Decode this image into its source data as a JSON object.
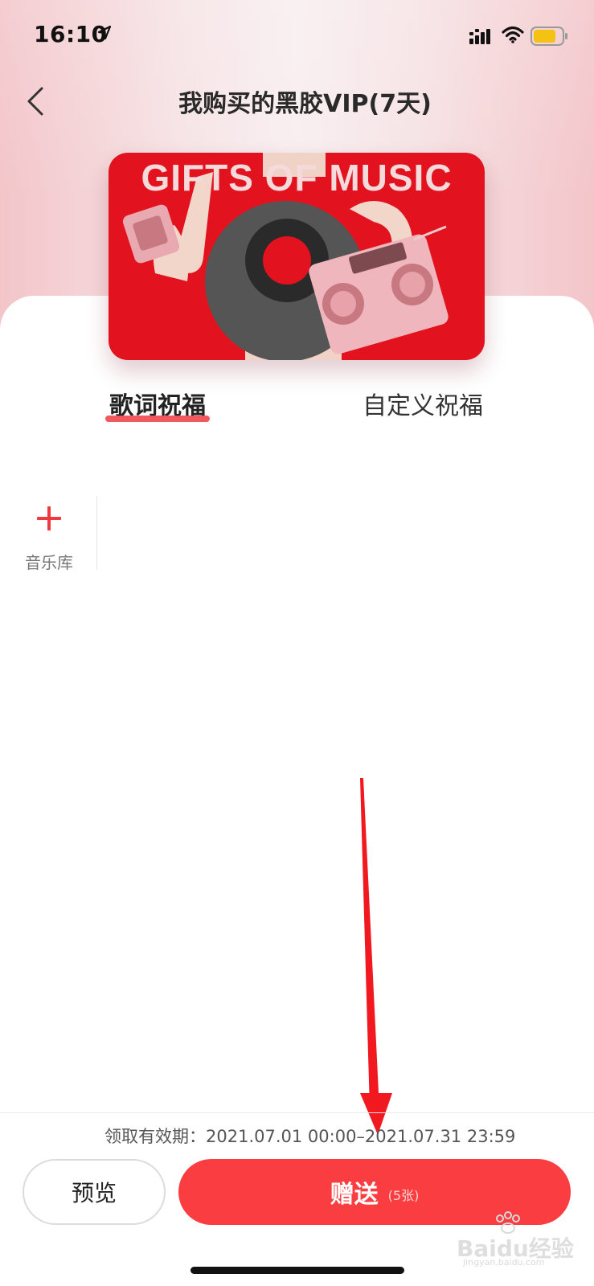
{
  "status_bar": {
    "time": "16:10"
  },
  "header": {
    "title": "我购买的黑胶VIP(7天)",
    "back_icon": "chevron-left-icon"
  },
  "card": {
    "title": "GIFTS OF MUSIC"
  },
  "tabs": [
    {
      "label": "歌词祝福",
      "active": true
    },
    {
      "label": "自定义祝福",
      "active": false
    }
  ],
  "music_library": {
    "label": "音乐库",
    "icon": "plus-icon"
  },
  "footer": {
    "validity": "领取有效期：2021.07.01 00:00–2021.07.31 23:59",
    "preview_label": "预览",
    "gift_label": "赠送",
    "gift_count": "(5张)"
  },
  "watermark": {
    "text": "Baidu经验",
    "sub": "jingyan.baidu.com"
  },
  "colors": {
    "accent": "#fa3d40",
    "card_red": "#e2131f"
  }
}
